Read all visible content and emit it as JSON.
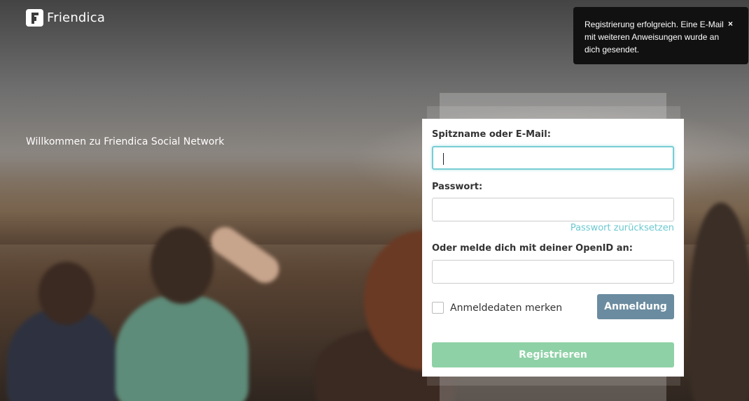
{
  "brand": {
    "name": "Friendica"
  },
  "welcome": {
    "text": "Willkommen zu Friendica Social Network"
  },
  "toast": {
    "message": "Registrierung erfolgreich. Eine E-Mail mit weiteren Anweisungen wurde an dich gesendet.",
    "close_label": "×"
  },
  "login_form": {
    "username_label": "Spitzname oder E-Mail:",
    "username_value": "",
    "password_label": "Passwort:",
    "password_value": "",
    "reset_password_link": "Passwort zurücksetzen",
    "openid_label": "Oder melde dich mit deiner OpenID an:",
    "openid_value": "",
    "remember_label": "Anmeldedaten merken",
    "remember_checked": false,
    "login_button": "Anmeldung",
    "register_button": "Registrieren"
  },
  "colors": {
    "focus_border": "#78cdd4",
    "link": "#6cc9d1",
    "login_button": "#6b8ca0",
    "register_button": "#8ed1a6",
    "toast_bg": "#111111"
  }
}
